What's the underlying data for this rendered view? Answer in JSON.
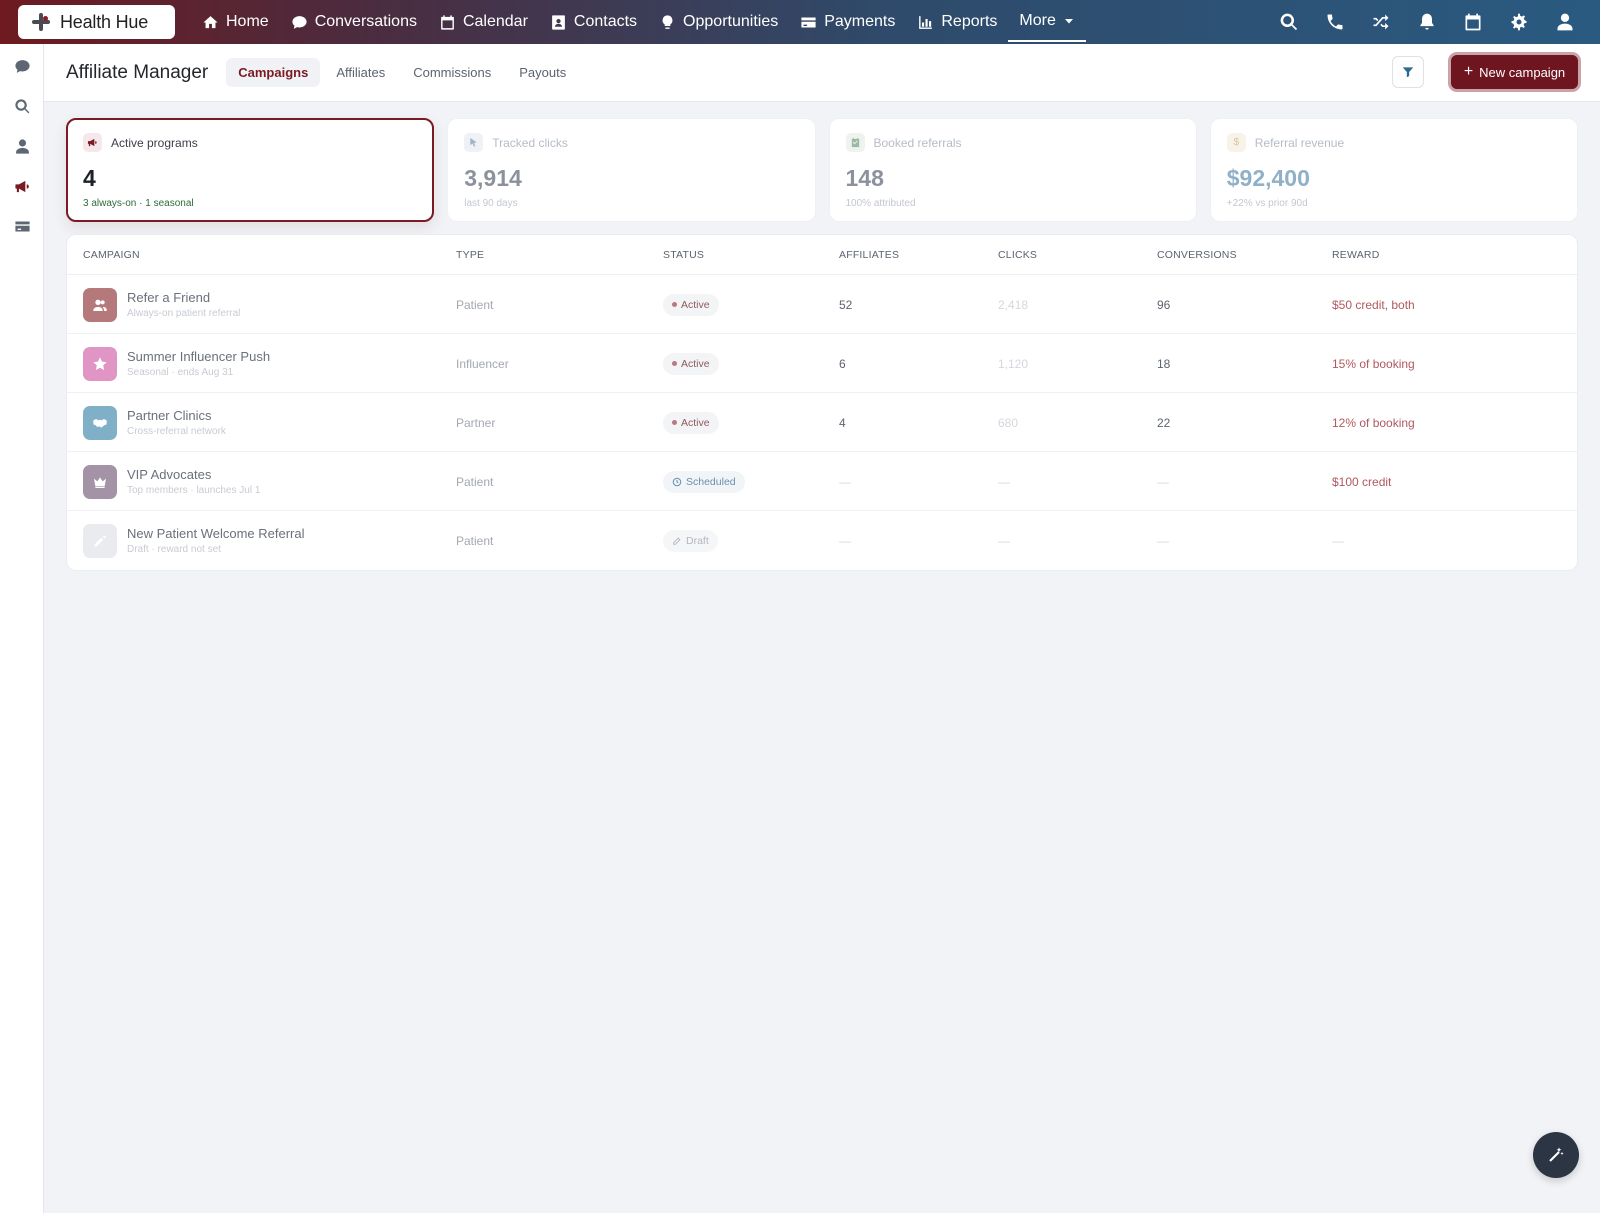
{
  "app": {
    "brand": "Health Hue"
  },
  "nav": {
    "items": [
      {
        "label": "Home",
        "icon": "home-icon"
      },
      {
        "label": "Conversations",
        "icon": "chat-icon"
      },
      {
        "label": "Calendar",
        "icon": "calendar-icon"
      },
      {
        "label": "Contacts",
        "icon": "contact-card-icon"
      },
      {
        "label": "Opportunities",
        "icon": "lightbulb-icon"
      },
      {
        "label": "Payments",
        "icon": "credit-card-icon"
      },
      {
        "label": "Reports",
        "icon": "bar-chart-icon"
      }
    ],
    "more_label": "More",
    "right_icons": [
      "search-icon",
      "phone-icon",
      "shuffle-icon",
      "bell-icon",
      "calendar-icon",
      "gear-icon",
      "user-icon"
    ]
  },
  "rail": {
    "icons": [
      "chat-icon",
      "search-icon",
      "user-icon",
      "megaphone-icon",
      "card-icon"
    ],
    "active": "megaphone-icon"
  },
  "page": {
    "title": "Affiliate Manager",
    "tabs": [
      {
        "label": "Campaigns",
        "active": true
      },
      {
        "label": "Affiliates",
        "active": false
      },
      {
        "label": "Commissions",
        "active": false
      },
      {
        "label": "Payouts",
        "active": false
      }
    ],
    "new_button": "New campaign"
  },
  "kpis": [
    {
      "label": "Active programs",
      "value": "4",
      "note": "3 always-on · 1 seasonal",
      "icon": "megaphone-icon",
      "active": true
    },
    {
      "label": "Tracked clicks",
      "value": "3,914",
      "note": "last 90 days",
      "icon": "cursor-icon",
      "active": false
    },
    {
      "label": "Booked referrals",
      "value": "148",
      "note": "100% attributed",
      "icon": "calendar-check-icon",
      "active": false
    },
    {
      "label": "Referral revenue",
      "value": "$92,400",
      "note": "+22% vs prior 90d",
      "icon": "dollar-icon",
      "active": false
    }
  ],
  "table": {
    "headers": [
      "CAMPAIGN",
      "TYPE",
      "STATUS",
      "AFFILIATES",
      "CLICKS",
      "CONVERSIONS",
      "REWARD"
    ],
    "rows": [
      {
        "name": "Refer a Friend",
        "sub": "Always-on patient referral",
        "type": "Patient",
        "status": "Active",
        "affiliates": "52",
        "clicks": "2,418",
        "conversions": "96",
        "reward": "$50 credit, both",
        "icon": "users-icon",
        "color": "#b5797c"
      },
      {
        "name": "Summer Influencer Push",
        "sub": "Seasonal · ends Aug 31",
        "type": "Influencer",
        "status": "Active",
        "affiliates": "6",
        "clicks": "1,120",
        "conversions": "18",
        "reward": "15% of booking",
        "icon": "star-icon",
        "color": "#e095c4"
      },
      {
        "name": "Partner Clinics",
        "sub": "Cross-referral network",
        "type": "Partner",
        "status": "Active",
        "affiliates": "4",
        "clicks": "680",
        "conversions": "22",
        "reward": "12% of booking",
        "icon": "handshake-icon",
        "color": "#7fb0c8"
      },
      {
        "name": "VIP Advocates",
        "sub": "Top members · launches Jul 1",
        "type": "Patient",
        "status": "Scheduled",
        "affiliates": "—",
        "clicks": "—",
        "conversions": "—",
        "reward": "$100 credit",
        "icon": "crown-icon",
        "color": "#a493a6"
      },
      {
        "name": "New Patient Welcome Referral",
        "sub": "Draft · reward not set",
        "type": "Patient",
        "status": "Draft",
        "affiliates": "—",
        "clicks": "—",
        "conversions": "—",
        "reward": "—",
        "icon": "pencil-icon",
        "color": "#e9ebee"
      }
    ]
  },
  "colors": {
    "accent": "#7a1a24",
    "nav_start": "#6e1a1f",
    "nav_end": "#2a5a80"
  }
}
